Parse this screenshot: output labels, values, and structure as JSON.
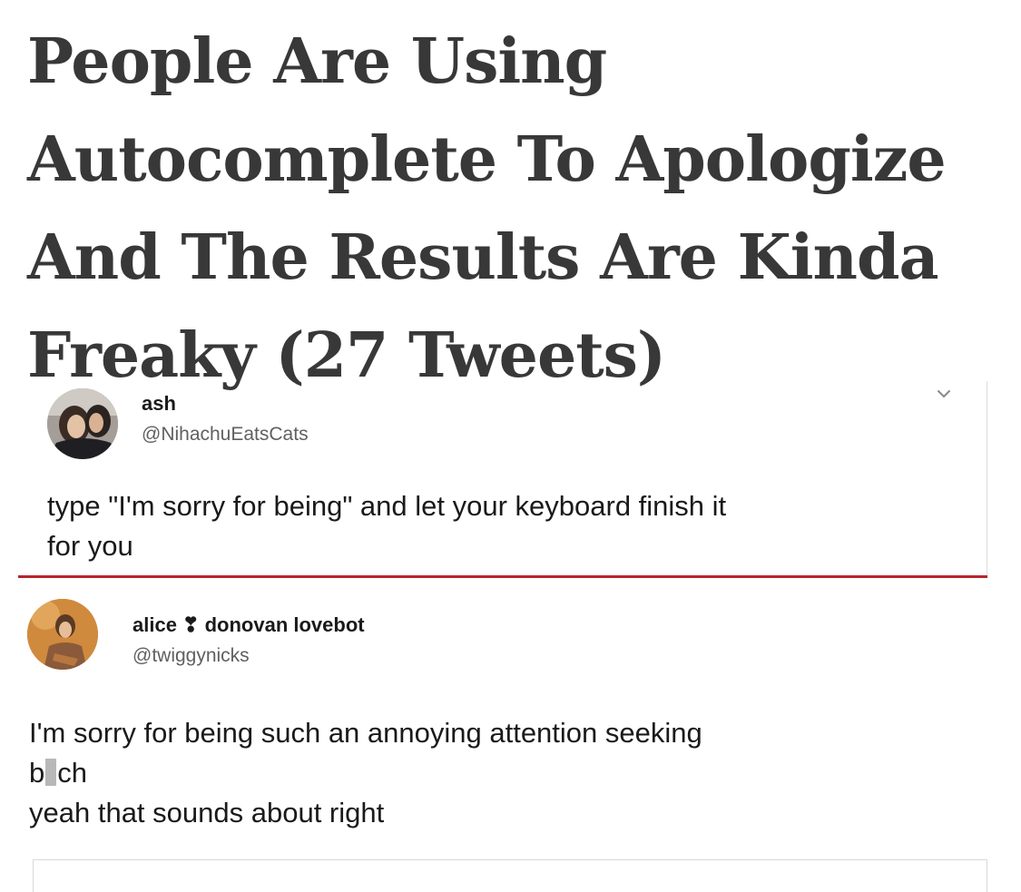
{
  "headline": "People Are Using Autocomplete To Apologize And The Results Are Kinda Freaky (27 Tweets)",
  "tweets": [
    {
      "display_name": "ash",
      "handle": "@NihachuEatsCats",
      "text_line1": "type \"I'm sorry for being\" and let your keyboard finish it",
      "text_line2": "for you",
      "menu_icon": "chevron-down-icon"
    },
    {
      "display_name": "alice ❣ donovan lovebot",
      "handle": "@twiggynicks",
      "text_line1": "I'm sorry for being such an annoying attention seeking",
      "text_line2_start": "b",
      "text_line2_end": "ch",
      "text_line3": "yeah that sounds about right"
    }
  ],
  "colors": {
    "headline": "#383838",
    "divider_accent": "#b7252a",
    "handle": "#606060"
  }
}
